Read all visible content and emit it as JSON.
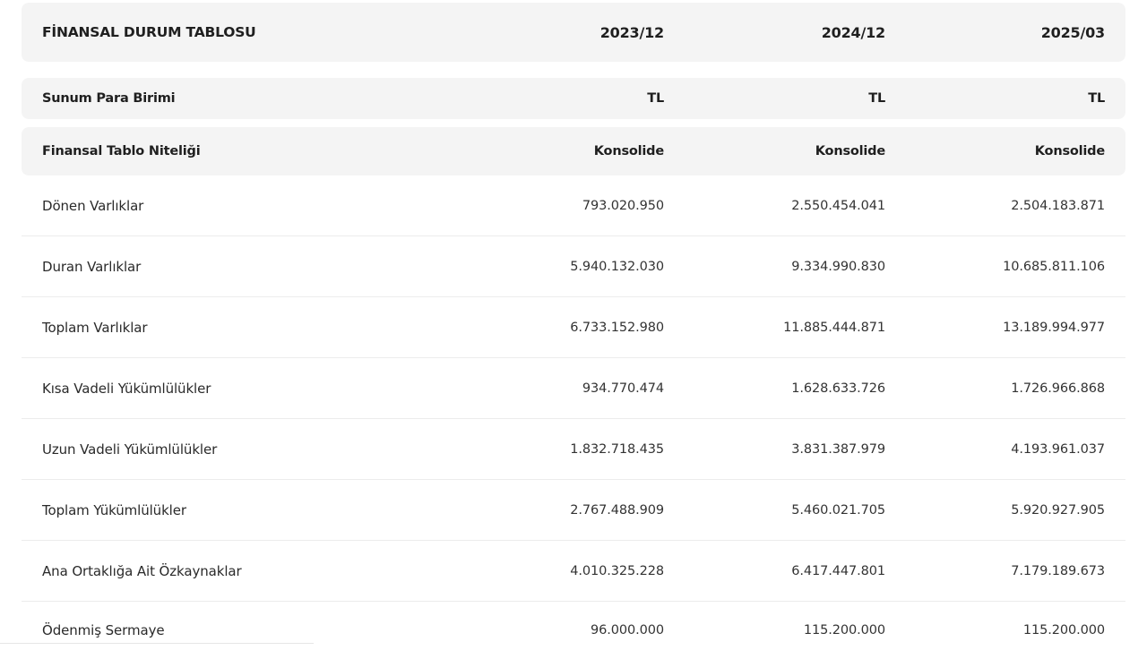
{
  "header": {
    "title": "FİNANSAL DURUM TABLOSU",
    "periods": [
      "2023/12",
      "2024/12",
      "2025/03"
    ]
  },
  "meta_rows": [
    {
      "label": "Sunum Para Birimi",
      "values": [
        "TL",
        "TL",
        "TL"
      ]
    },
    {
      "label": "Finansal Tablo Niteliği",
      "values": [
        "Konsolide",
        "Konsolide",
        "Konsolide"
      ]
    }
  ],
  "rows": [
    {
      "label": "Dönen Varlıklar",
      "values": [
        "793.020.950",
        "2.550.454.041",
        "2.504.183.871"
      ]
    },
    {
      "label": "Duran Varlıklar",
      "values": [
        "5.940.132.030",
        "9.334.990.830",
        "10.685.811.106"
      ]
    },
    {
      "label": "Toplam Varlıklar",
      "values": [
        "6.733.152.980",
        "11.885.444.871",
        "13.189.994.977"
      ]
    },
    {
      "label": "Kısa Vadeli Yükümlülükler",
      "values": [
        "934.770.474",
        "1.628.633.726",
        "1.726.966.868"
      ]
    },
    {
      "label": "Uzun Vadeli Yükümlülükler",
      "values": [
        "1.832.718.435",
        "3.831.387.979",
        "4.193.961.037"
      ]
    },
    {
      "label": "Toplam Yükümlülükler",
      "values": [
        "2.767.488.909",
        "5.460.021.705",
        "5.920.927.905"
      ]
    },
    {
      "label": "Ana Ortaklığa Ait Özkaynaklar",
      "values": [
        "4.010.325.228",
        "6.417.447.801",
        "7.179.189.673"
      ]
    },
    {
      "label": "Ödenmiş Sermaye",
      "values": [
        "96.000.000",
        "115.200.000",
        "115.200.000"
      ]
    }
  ]
}
